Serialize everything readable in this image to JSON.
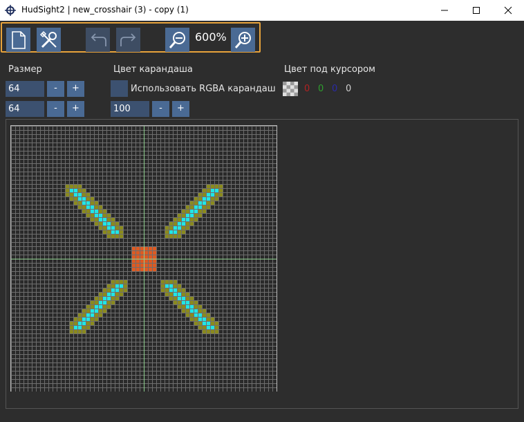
{
  "window": {
    "title": "HudSight2 | new_crosshair (3) - copy (1)",
    "icons": [
      "crosshair-app-icon",
      "minimize-icon",
      "maximize-icon",
      "close-icon"
    ]
  },
  "toolbar": {
    "icons": [
      "new-file-icon",
      "tools-icon",
      "undo-icon",
      "redo-icon",
      "zoom-out-icon",
      "zoom-in-icon"
    ],
    "zoom_label": "600%"
  },
  "size_panel": {
    "label": "Размер",
    "width": "64",
    "height": "64",
    "minus_label": "-",
    "plus_label": "+"
  },
  "pencil_panel": {
    "label": "Цвет карандаша",
    "checkbox_label": "Использовать RGBA карандаш",
    "value": "100",
    "minus_label": "-",
    "plus_label": "+"
  },
  "cursor_panel": {
    "label": "Цвет под курсором",
    "r": "0",
    "g": "0",
    "b": "0",
    "a": "0",
    "colors": {
      "r": "#b22222",
      "g": "#2e9e2e",
      "b": "#2a2aa8",
      "a": "#d0d0d0"
    }
  },
  "canvas": {
    "grid_cells": 64,
    "colors": {
      "background": "#2a2a2a",
      "gridline": "#6e6e6e",
      "guide": "#8fd08f",
      "cyan": "#21e6e6",
      "olive": "#8a8a1e",
      "orange": "#dd5a22"
    }
  }
}
